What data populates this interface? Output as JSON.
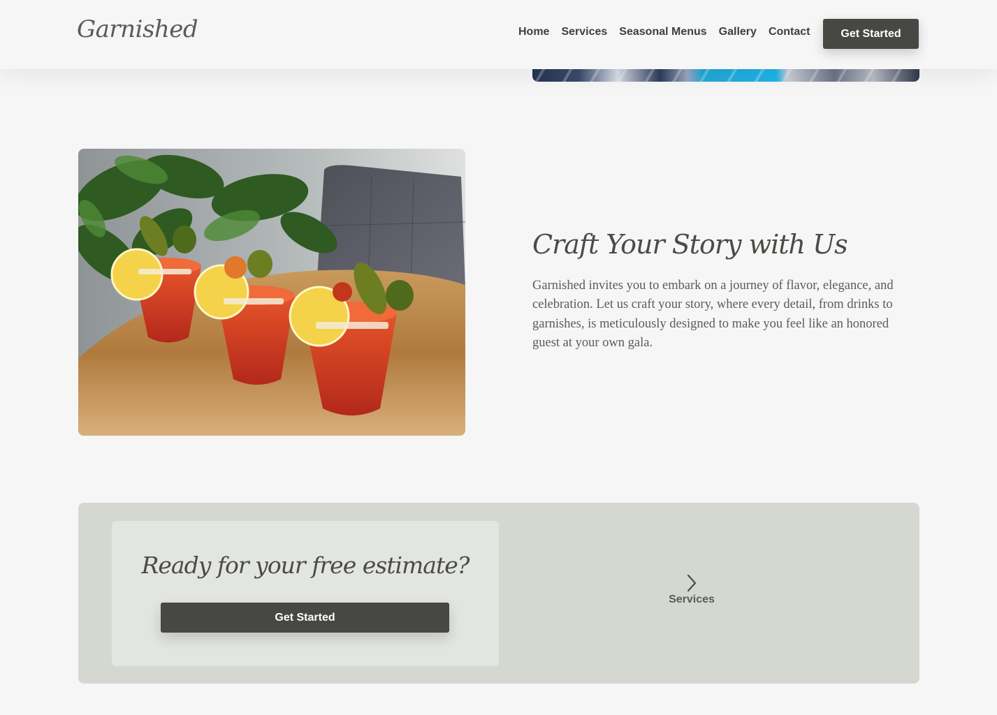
{
  "header": {
    "logo": "Garnished",
    "nav": [
      "Home",
      "Services",
      "Seasonal Menus",
      "Gallery",
      "Contact"
    ],
    "cta_label": "Get Started"
  },
  "story": {
    "image_alt": "Three bloody mary cocktails garnished with pickles, peppers and lemon slices on a wooden table",
    "title": "Craft Your Story with Us",
    "body": "Garnished invites you to embark on a journey of flavor, elegance, and celebration. Let us craft your story, where every detail, from drinks to garnishes, is meticulously designed to make you feel like an honored guest at your own gala."
  },
  "cta": {
    "title": "Ready for your free estimate?",
    "button_label": "Get Started",
    "next_link_label": "Services"
  },
  "colors": {
    "page_bg": "#f6f6f6",
    "button_bg": "#474844",
    "band_bg": "#d5d8d1",
    "card_bg": "#e3e5e1",
    "text": "#454642"
  },
  "icons": {
    "next": "chevron-right-icon"
  }
}
